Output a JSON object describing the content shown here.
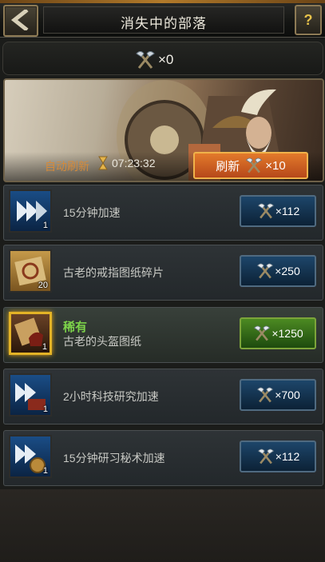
{
  "header": {
    "title": "消失中的部落"
  },
  "currency": {
    "count": "×0",
    "icon": "battle-axe-icon"
  },
  "banner": {
    "auto_refresh_label": "自动刷新",
    "timer": "07:23:32",
    "refresh_label": "刷新",
    "refresh_cost": "×10"
  },
  "items": [
    {
      "name": "15分钟加速",
      "qty": "1",
      "price": "×112",
      "rare_label": ""
    },
    {
      "name": "古老的戒指图纸碎片",
      "qty": "20",
      "price": "×250",
      "rare_label": ""
    },
    {
      "name": "古老的头盔图纸",
      "qty": "1",
      "price": "×1250",
      "rare_label": "稀有"
    },
    {
      "name": "2小时科技研究加速",
      "qty": "1",
      "price": "×700",
      "rare_label": ""
    },
    {
      "name": "15分钟研习秘术加速",
      "qty": "1",
      "price": "×112",
      "rare_label": ""
    }
  ],
  "colors": {
    "refresh_button": "#d4622a",
    "price_button": "#133452",
    "rare_button": "#3d7a1c",
    "rare_text": "#7dd44a"
  }
}
